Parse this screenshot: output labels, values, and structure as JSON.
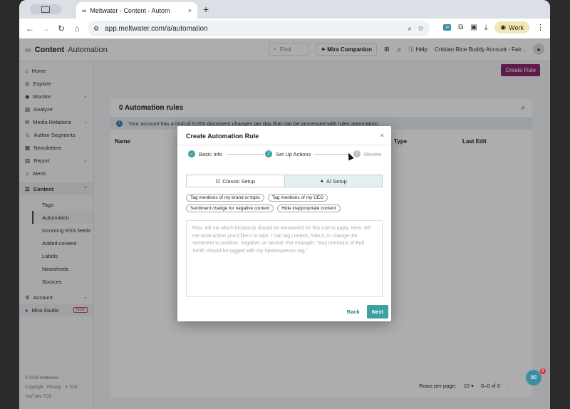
{
  "browser": {
    "tab_title": "Meltwater - Content - Autom",
    "tab_close": "×",
    "new_tab": "+",
    "url": "app.meltwater.com/a/automation",
    "profile": "Work"
  },
  "app": {
    "brand_name": "Content",
    "brand_sub": "Automation",
    "find_placeholder": "Find",
    "mira_companion": "Mira Companion",
    "help": "Help",
    "account_name": "Cristian Rice Buddy Account - Fair..."
  },
  "sidebar": {
    "items": [
      {
        "label": "Home",
        "icon": "home-icon"
      },
      {
        "label": "Explore",
        "icon": "explore-icon"
      },
      {
        "label": "Monitor",
        "icon": "monitor-icon",
        "chevron": true
      },
      {
        "label": "Analyze",
        "icon": "analyze-icon"
      },
      {
        "label": "Media Relations",
        "icon": "media-relations-icon",
        "chevron": true
      },
      {
        "label": "Author Segments",
        "icon": "author-segments-icon"
      },
      {
        "label": "Newsletters",
        "icon": "newsletters-icon"
      },
      {
        "label": "Report",
        "icon": "report-icon",
        "chevron": true
      },
      {
        "label": "Alerts",
        "icon": "alerts-icon"
      }
    ],
    "content_section": "Content",
    "content_sub": [
      "Tags",
      "Automation",
      "Incoming RSS feeds",
      "Added content",
      "Labels",
      "Newsfeeds",
      "Sources"
    ],
    "active_sub": "Automation",
    "account": "Account",
    "mira_studio": "Mira Studio",
    "new_badge": "New",
    "footer_line1": "© 2026 Meltwater",
    "footer_line2": "Copyright · Privacy · X TOS ·",
    "footer_line3": "YouTube TOS"
  },
  "main": {
    "create_rule": "Create Rule",
    "panel_title": "0 Automation rules",
    "info_text": "Your account has a limit of 5,000 document changes per day that can be processed with rules automation.",
    "col_name": "Name",
    "col_type": "Type",
    "col_last_edit": "Last Edit",
    "rows_per_page_label": "Rows per page:",
    "rows_per_page_value": "10",
    "page_range": "0–0 of 0"
  },
  "modal": {
    "title": "Create Automation Rule",
    "close": "×",
    "steps": [
      {
        "label": "Basic Info",
        "state": "done"
      },
      {
        "label": "Set Up Actions",
        "state": "current",
        "number": "2"
      },
      {
        "label": "Review",
        "state": "pending",
        "number": "3"
      }
    ],
    "tab_classic": "Classic Setup",
    "tab_ai": "AI Setup",
    "chips": [
      [
        "Tag mentions of my brand or topic",
        "Tag mentions of my CEO"
      ],
      [
        "Sentiment change for negative content",
        "Hide inappropriate content"
      ]
    ],
    "prompt_placeholder": "First, tell me which keywords should be mentioned for this rule to apply. Next, tell me what action you'd like it to take. I can tag content, hide it, or change the sentiment to positive, negative, or neutral. For example, \"Any mentions of Bob Smith should be tagged with my Spokesperson tag.\"",
    "back": "Back",
    "next": "Next"
  },
  "chat_badge": "2",
  "colors": {
    "accent_teal": "#3fa0a0",
    "create_rule_purple": "#8a2a6e"
  }
}
